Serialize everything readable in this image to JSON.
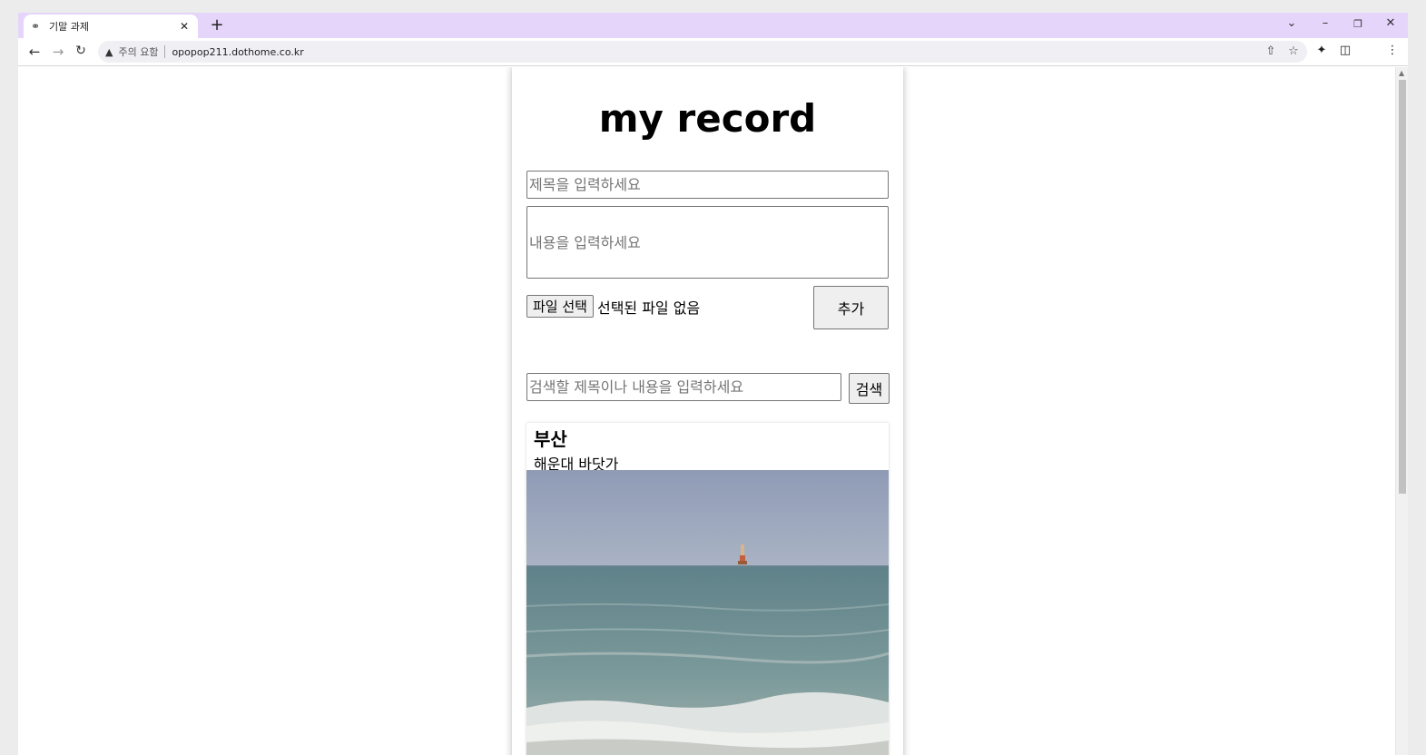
{
  "browser": {
    "tab_title": "기말 과제",
    "security_label": "주의 요함",
    "url": "opopop211.dothome.co.kr"
  },
  "app": {
    "title": "my record",
    "title_placeholder": "제목을 입력하세요",
    "content_placeholder": "내용을 입력하세요",
    "file_button_label": "파일 선택",
    "file_status": "선택된 파일 없음",
    "add_button_label": "추가",
    "search_placeholder": "검색할 제목이나 내용을 입력하세요",
    "search_button_label": "검색"
  },
  "records": [
    {
      "title": "부산",
      "body": "해운대 바닷가"
    }
  ],
  "colors": {
    "tabstrip": "#e5d5fb",
    "sky": "#9aa6bc",
    "sea": "#6b8c93",
    "foam": "#e7e9e8"
  },
  "icons": [
    "globe-icon",
    "close-icon",
    "plus-icon",
    "chevron-down-icon",
    "minimize-icon",
    "restore-icon",
    "back-arrow-icon",
    "forward-arrow-icon",
    "reload-icon",
    "warning-icon",
    "share-icon",
    "star-icon",
    "puzzle-icon",
    "sidepanel-icon",
    "menu-dots-icon"
  ]
}
